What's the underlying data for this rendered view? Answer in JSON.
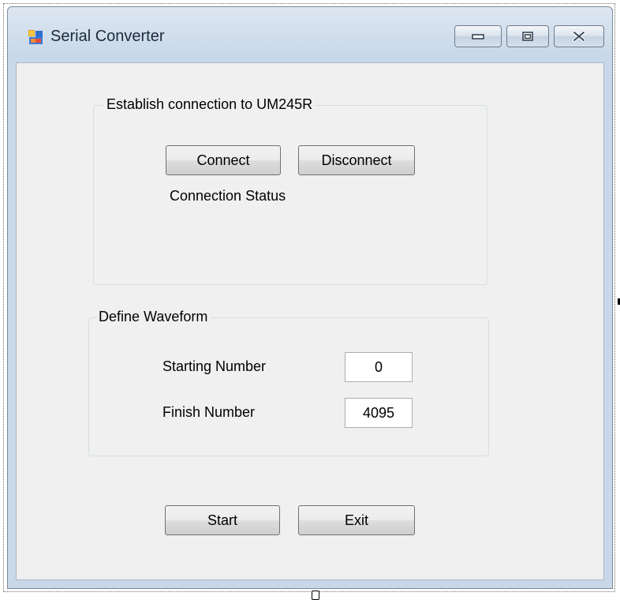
{
  "window": {
    "title": "Serial Converter"
  },
  "connection_group": {
    "legend": "Establish connection to UM245R",
    "connect_label": "Connect",
    "disconnect_label": "Disconnect",
    "status_label": "Connection Status"
  },
  "waveform_group": {
    "legend": "Define Waveform",
    "starting_label": "Starting Number",
    "starting_value": "0",
    "finish_label": "Finish Number",
    "finish_value": "4095"
  },
  "actions": {
    "start_label": "Start",
    "exit_label": "Exit"
  },
  "icons": {
    "app": "application-window-icon",
    "minimize": "minimize-icon",
    "maximize": "maximize-icon",
    "close": "close-icon"
  },
  "colors": {
    "client_background": "#f0f0f0",
    "titlebar": "#d3e0ee"
  }
}
